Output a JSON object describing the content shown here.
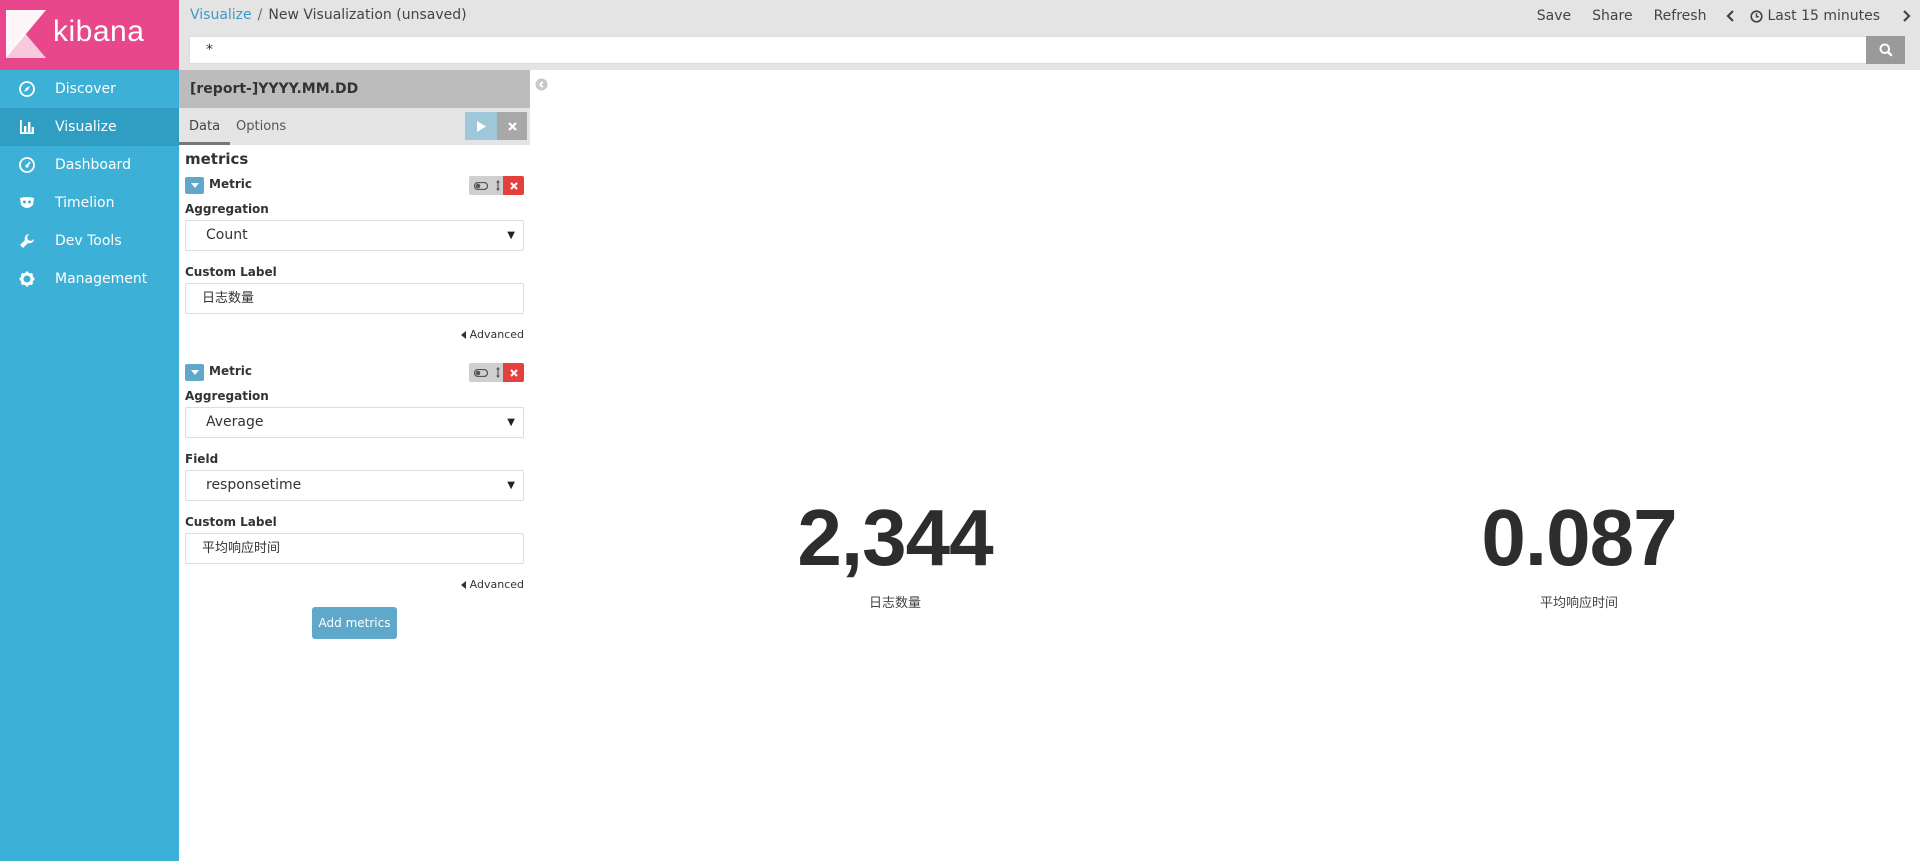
{
  "brand": {
    "name": "kibana",
    "logo_color": "#e8478b",
    "sidebar_color": "#3cb0d6",
    "active_color": "#2f9ec2"
  },
  "nav": {
    "items": [
      {
        "label": "Discover",
        "icon": "compass-icon"
      },
      {
        "label": "Visualize",
        "icon": "bar-chart-icon"
      },
      {
        "label": "Dashboard",
        "icon": "gauge-icon"
      },
      {
        "label": "Timelion",
        "icon": "mask-icon"
      },
      {
        "label": "Dev Tools",
        "icon": "wrench-icon"
      },
      {
        "label": "Management",
        "icon": "gear-icon"
      }
    ],
    "active": "Visualize"
  },
  "breadcrumb": {
    "parent": "Visualize",
    "separator": "/",
    "current": "New Visualization (unsaved)"
  },
  "top_actions": {
    "save": "Save",
    "share": "Share",
    "refresh": "Refresh",
    "time_range": "Last 15 minutes"
  },
  "query": {
    "value": "*"
  },
  "editor": {
    "index_pattern": "[report-]YYYY.MM.DD",
    "tabs": {
      "data": "Data",
      "options": "Options"
    },
    "section_title": "metrics",
    "metrics": [
      {
        "title": "Metric",
        "aggregation_label": "Aggregation",
        "aggregation": "Count",
        "custom_label_label": "Custom Label",
        "custom_label": "日志数量",
        "advanced": "Advanced"
      },
      {
        "title": "Metric",
        "aggregation_label": "Aggregation",
        "aggregation": "Average",
        "field_label": "Field",
        "field": "responsetime",
        "custom_label_label": "Custom Label",
        "custom_label": "平均响应时间",
        "advanced": "Advanced"
      }
    ],
    "add_metrics": "Add metrics"
  },
  "visualization": {
    "metrics": [
      {
        "value": "2,344",
        "label": "日志数量"
      },
      {
        "value": "0.087",
        "label": "平均响应时间"
      }
    ]
  }
}
